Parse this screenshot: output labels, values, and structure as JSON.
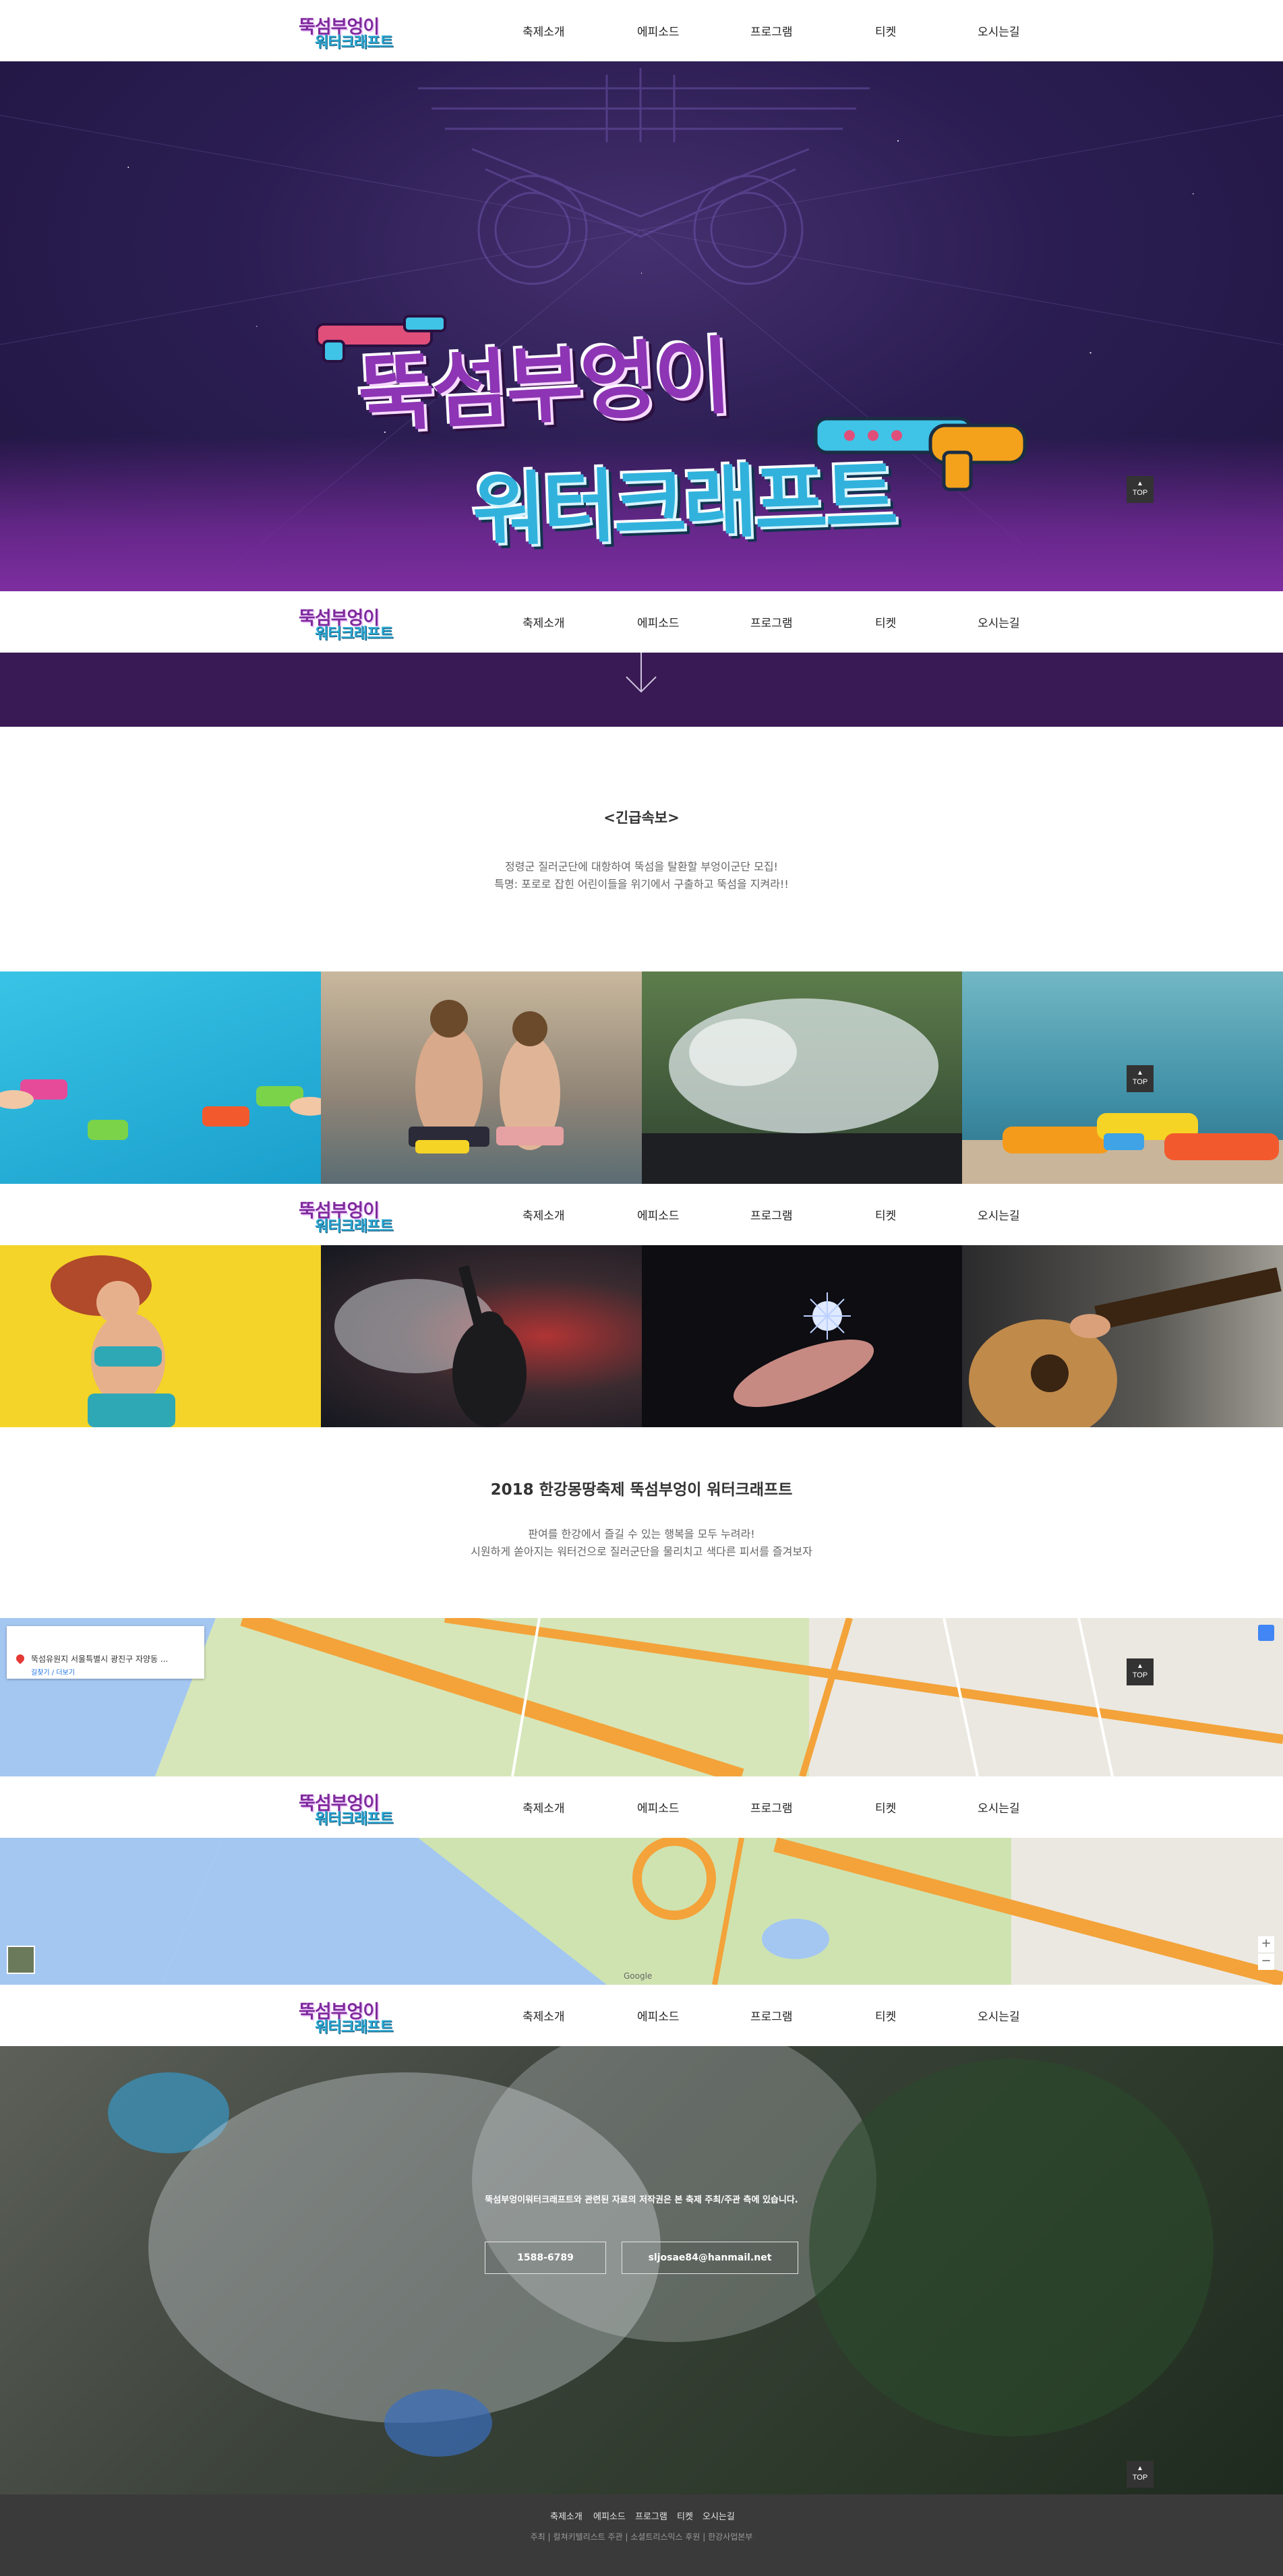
{
  "logo": {
    "line1": "뚝섬부엉이",
    "line2": "워터크래프트"
  },
  "nav": {
    "items": [
      "축제소개",
      "에피소드",
      "프로그램",
      "티켓",
      "오시는길"
    ]
  },
  "hero": {
    "title_line1": "뚝섬부엉이",
    "title_line2": "워터크래프트"
  },
  "notice": {
    "title": "<긴급속보>",
    "lines": [
      "정령군 질러군단에 대항하여 뚝섬을 탈환할 부엉이군단 모집!",
      "특명: 포로로 잡힌 어린이들을 위기에서 구출하고 뚝섬을 지켜라!!"
    ]
  },
  "festival": {
    "title": "2018 한강몽땅축제 뚝섬부엉이 워터크래프트",
    "lines": [
      "판여를 한강에서 즐길 수 있는 행복을 모두 누려라!",
      "시원하게 쏟아지는 워터건으로 질러군단을 물리치고 색다른 피서를 즐겨보자"
    ]
  },
  "map": {
    "address": "뚝섬유원지 서울특별시 광진구 자양동 ...",
    "link": "길찾기 / 더보기",
    "google": "Google"
  },
  "contact": {
    "text": "뚝섬부엉이워터크래프트와 관련된 자료의 저작권은 본 축제 주최/주관 측에 있습니다.",
    "phone": "1588-6789",
    "email": "sljosae84@hanmail.net"
  },
  "footer": {
    "menu": [
      "축제소개",
      "에피소드",
      "프로그램",
      "티켓",
      "오시는길"
    ],
    "credits": "주최 | 컬쳐키텔리스트   주관 | 소셜트리스믹스   후원 | 한강사업본부"
  },
  "top_button": {
    "label": "TOP"
  },
  "colors": {
    "brand_purple": "#7e2a9c",
    "brand_blue": "#2ba9d4",
    "footer_bg": "#3a3a3a"
  }
}
